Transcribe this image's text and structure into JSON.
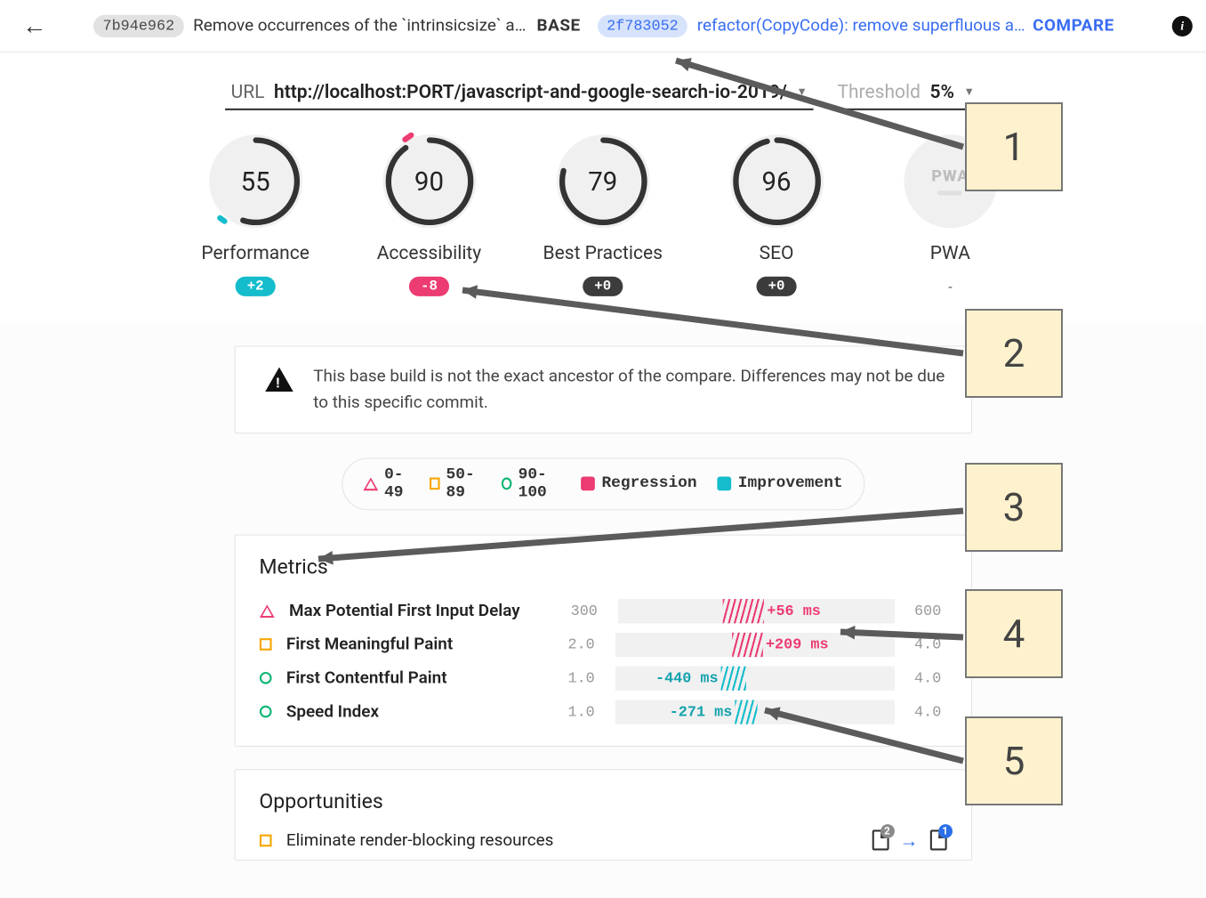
{
  "header": {
    "base_hash": "7b94e962",
    "base_msg": "Remove occurrences of the `intrinsicsize` attrib…",
    "base_label": "BASE",
    "compare_hash": "2f783052",
    "compare_msg": "refactor(CopyCode): remove superfluous a…",
    "compare_label": "COMPARE"
  },
  "url_row": {
    "url_label": "URL",
    "url_value": "http://localhost:PORT/javascript-and-google-search-io-2019/",
    "threshold_label": "Threshold",
    "threshold_value": "5%"
  },
  "gauges": [
    {
      "score": "55",
      "label": "Performance",
      "delta": "+2",
      "delta_style": "teal",
      "arc_pct": 55
    },
    {
      "score": "90",
      "label": "Accessibility",
      "delta": "-8",
      "delta_style": "pink",
      "arc_pct": 90
    },
    {
      "score": "79",
      "label": "Best Practices",
      "delta": "+0",
      "delta_style": "dark",
      "arc_pct": 79
    },
    {
      "score": "96",
      "label": "SEO",
      "delta": "+0",
      "delta_style": "dark",
      "arc_pct": 96
    },
    {
      "score": "",
      "label": "PWA",
      "delta": "-",
      "delta_style": "none",
      "pwa": true
    }
  ],
  "warning": "This base build is not the exact ancestor of the compare. Differences may not be due to this specific commit.",
  "legend": {
    "r1": "0-49",
    "r2": "50-89",
    "r3": "90-100",
    "reg": "Regression",
    "imp": "Improvement"
  },
  "metrics_title": "Metrics",
  "metrics": [
    {
      "shape": "tri",
      "name": "Max Potential First Input Delay",
      "min": "300",
      "max": "600",
      "delta": "+56 ms",
      "color": "pink",
      "bar_start": 38,
      "bar_end": 53,
      "label_side": "right"
    },
    {
      "shape": "sq",
      "name": "First Meaningful Paint",
      "min": "2.0",
      "max": "4.0",
      "delta": "+209 ms",
      "color": "pink",
      "bar_start": 42,
      "bar_end": 53,
      "label_side": "right"
    },
    {
      "shape": "circ",
      "name": "First Contentful Paint",
      "min": "1.0",
      "max": "4.0",
      "delta": "-440 ms",
      "color": "teal",
      "bar_start": 38,
      "bar_end": 47,
      "label_side": "left"
    },
    {
      "shape": "circ",
      "name": "Speed Index",
      "min": "1.0",
      "max": "4.0",
      "delta": "-271 ms",
      "color": "teal",
      "bar_start": 43,
      "bar_end": 51,
      "label_side": "left"
    }
  ],
  "opps_title": "Opportunities",
  "opps": [
    {
      "shape": "sq",
      "name": "Eliminate render-blocking resources",
      "badge1": "2",
      "badge2": "1"
    }
  ],
  "annotations": [
    "1",
    "2",
    "3",
    "4",
    "5"
  ]
}
